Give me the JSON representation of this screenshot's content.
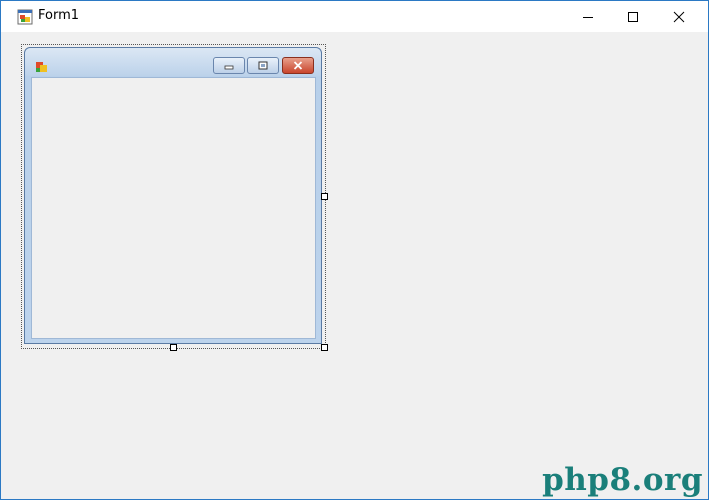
{
  "window": {
    "title": "Form1",
    "icon": "winforms-app-icon",
    "controls": [
      "minimize-icon",
      "maximize-icon",
      "close-icon"
    ]
  },
  "child_form": {
    "icon": "winforms-app-icon",
    "controls": [
      "minimize-icon",
      "restore-icon",
      "close-icon"
    ]
  },
  "watermark": "php8.org",
  "colors": {
    "client_bg": "#f0f0f0",
    "border": "#2b79c4",
    "child_title": "#bcd2ea",
    "close_button": "#c9452c",
    "watermark": "#1a7f7a"
  }
}
